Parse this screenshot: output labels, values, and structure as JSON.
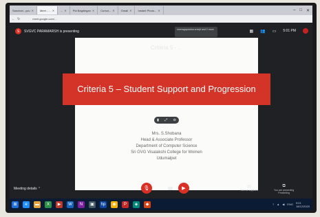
{
  "browser": {
    "tabs": [
      {
        "label": "Sanchari...you"
      },
      {
        "label": "Meet - ...",
        "active": true
      },
      {
        "label": "..."
      },
      {
        "label": "Pia Bagdingan"
      },
      {
        "label": "Cursor..."
      },
      {
        "label": "Gmail"
      },
      {
        "label": "Instant Photo..."
      }
    ],
    "url": "meet.google.com/..."
  },
  "meet": {
    "presenter_text": "SVGVC PARAMARSH is presenting",
    "presenter_initial": "S",
    "participant_tile": "sreeragapradna sreejit and 2 more",
    "clock": "5:01 PM"
  },
  "slide": {
    "ghost_text": "Criteria 5 - ...",
    "heading": "Criteria 5 – Student Support and Progression",
    "credits": [
      "Mrs. S.Shobana",
      "Head & Associate Professor",
      "Department of Computer Science",
      "Sri GVG Visalakshi College for Women",
      "Udumalpet"
    ]
  },
  "controls": {
    "meeting_details": "Meeting details ⌃",
    "turn_on_captions": "Turn on captions",
    "you_are_presenting": "You are presenting",
    "presenting_sub": "Presenting"
  },
  "taskbar": {
    "time": "5:01",
    "date": "18/12/2020",
    "lang": "ENG"
  },
  "colors": {
    "banner": "#d43327",
    "meet_bg": "#202124",
    "red": "#d93025"
  }
}
